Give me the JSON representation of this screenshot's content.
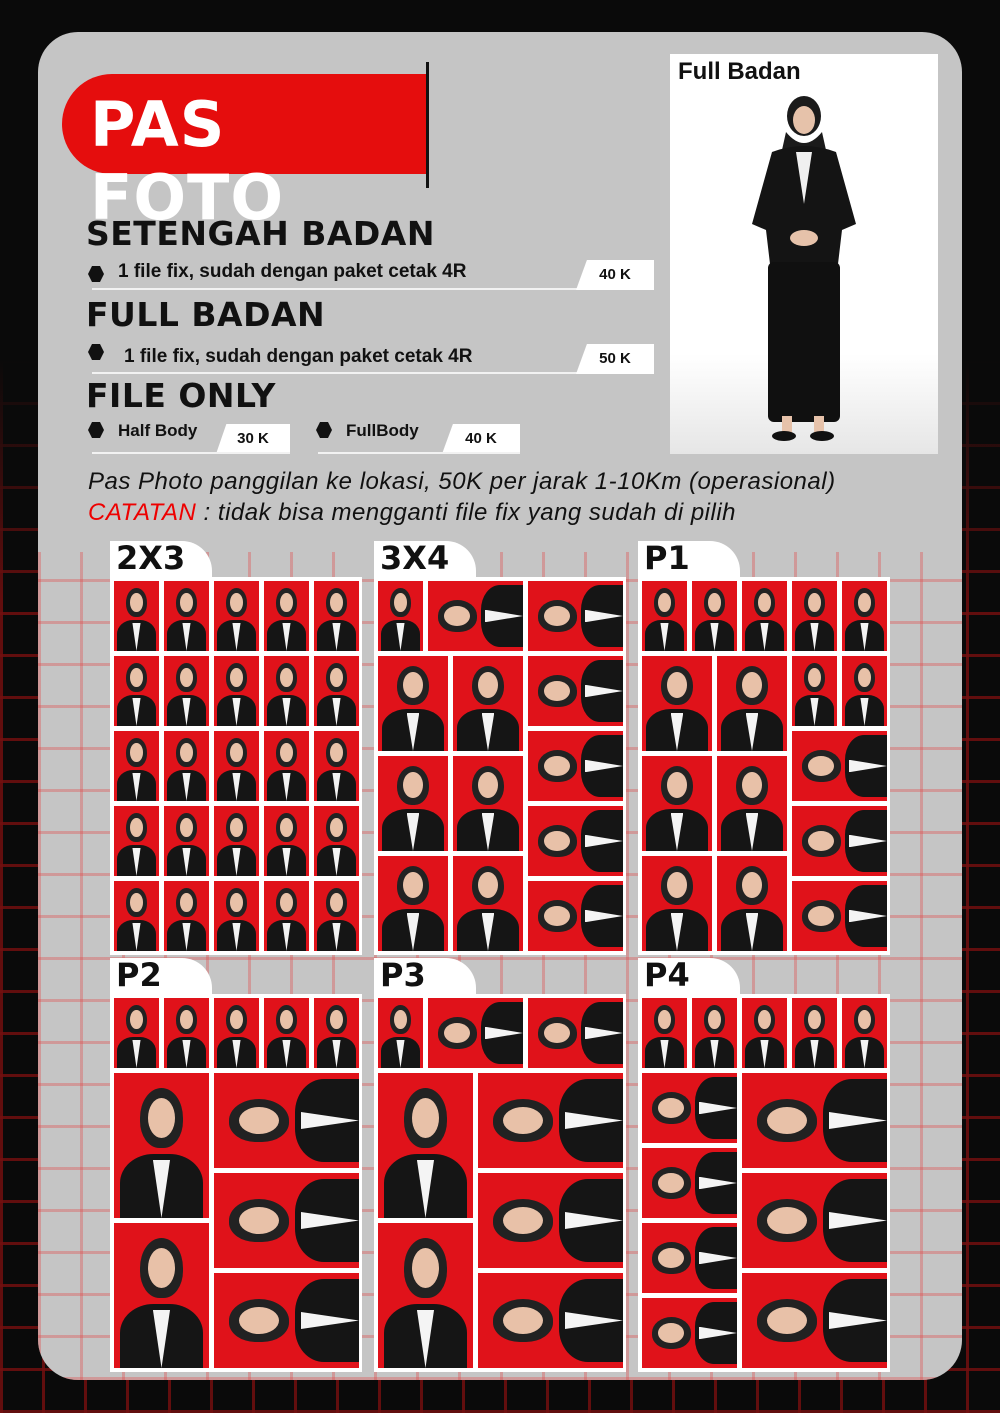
{
  "title": "PAS FOTO",
  "services": {
    "setengah_badan": {
      "heading": "SETENGAH BADAN",
      "desc": "1 file fix, sudah dengan paket cetak 4R",
      "price": "40 K"
    },
    "full_badan": {
      "heading": "FULL BADAN",
      "desc": "1 file fix, sudah dengan paket cetak 4R",
      "price": "50 K"
    },
    "file_only": {
      "heading": "FILE ONLY",
      "half_label": "Half Body",
      "half_price": "30 K",
      "full_label": "FullBody",
      "full_price": "40 K"
    }
  },
  "fullbody_photo": {
    "label": "Full Badan"
  },
  "notes": {
    "line1": "Pas Photo panggilan ke lokasi, 50K per jarak 1-10Km (operasional)",
    "catatan_label": "CATATAN",
    "catatan_text": " : tidak bisa mengganti file fix yang sudah di pilih"
  },
  "packages": [
    {
      "label": "2X3"
    },
    {
      "label": "3X4"
    },
    {
      "label": "P1"
    },
    {
      "label": "P2"
    },
    {
      "label": "P3"
    },
    {
      "label": "P4"
    }
  ],
  "colors": {
    "accent": "#e50d0d",
    "card": "#c5c5c5",
    "background": "#0a0a0a"
  }
}
